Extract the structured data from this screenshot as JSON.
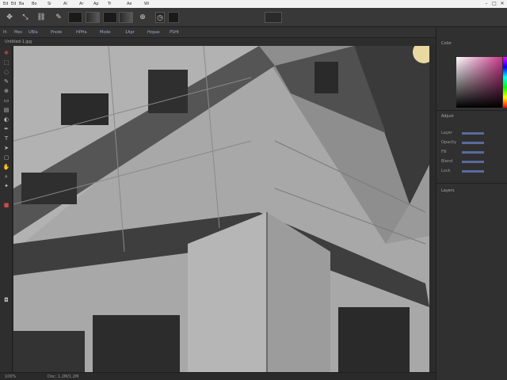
{
  "menubar": {
    "items": [
      "Ed",
      "Ed",
      "Ba",
      "Bo",
      "Si",
      "Al",
      "Ar",
      "Ap",
      "Tr",
      "Ae",
      "Wi"
    ],
    "window_controls": [
      "–",
      "□",
      "✕"
    ]
  },
  "options_bar": {
    "tool_icons": [
      "move-arrow",
      "scale",
      "link",
      "brush-preset",
      "stamp",
      "clock"
    ]
  },
  "secondary_bar": {
    "items": [
      "Ih",
      "Mes",
      "UBIa",
      "Prede",
      "HPHa",
      "Mode",
      "1Apr",
      "Hopas",
      "PSHt"
    ]
  },
  "document_tab": {
    "label": "Untitled-1.jpg"
  },
  "tools": [
    {
      "icon": "move-icon",
      "glyph": "✥"
    },
    {
      "icon": "marquee-icon",
      "glyph": "⬚"
    },
    {
      "icon": "lasso-icon",
      "glyph": "◌"
    },
    {
      "icon": "brush-icon",
      "glyph": "✎"
    },
    {
      "icon": "stamp-icon",
      "glyph": "⊕"
    },
    {
      "icon": "eraser-icon",
      "glyph": "▭"
    },
    {
      "icon": "gradient-icon",
      "glyph": "▤"
    },
    {
      "icon": "dodge-icon",
      "glyph": "◐"
    },
    {
      "icon": "pen-icon",
      "glyph": "✒"
    },
    {
      "icon": "text-icon",
      "glyph": "T"
    },
    {
      "icon": "path-select-icon",
      "glyph": "➤"
    },
    {
      "icon": "shape-icon",
      "glyph": "▢"
    },
    {
      "icon": "hand-icon",
      "glyph": "✋"
    },
    {
      "icon": "zoom-icon",
      "glyph": "⌕"
    },
    {
      "icon": "eyedropper-icon",
      "glyph": "✦"
    },
    {
      "icon": "foreground-color-icon",
      "glyph": "■"
    },
    {
      "icon": "mask-icon",
      "glyph": "◘"
    }
  ],
  "right_panel": {
    "color_header": "Color",
    "adjust_header": "Adjust",
    "rows": [
      "Layer",
      "Opacity",
      "Fill",
      "Blend",
      "Lock"
    ],
    "layers_header": "Layers"
  },
  "status": {
    "zoom": "100%",
    "doc": "Doc: 1.2M/1.2M"
  },
  "colors": {
    "accent": "#5a6aa0",
    "brand_red": "#d24a4a",
    "picker_hue": "#c8388a"
  }
}
